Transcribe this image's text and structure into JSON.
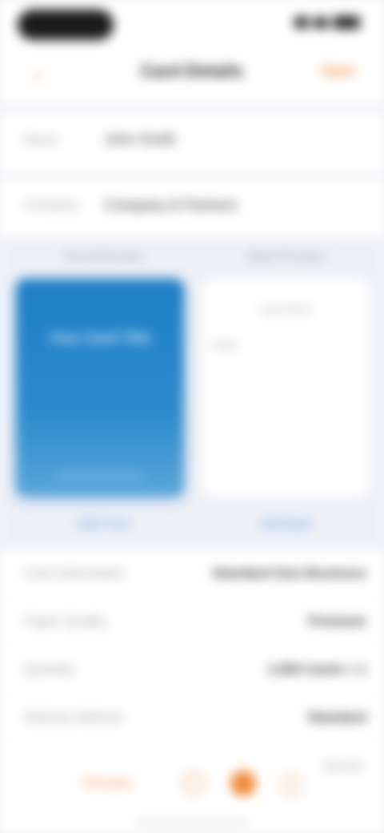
{
  "status_bar": {
    "time": ""
  },
  "nav": {
    "back": "‹",
    "title": "Card Details",
    "action": "Save"
  },
  "form": [
    {
      "label": "Name",
      "value": "John Smith"
    },
    {
      "label": "Company",
      "value": "Company & Partners"
    }
  ],
  "cards": {
    "left": {
      "title": "Front Preview",
      "heading": "Your Card Title",
      "link": "Edit Front"
    },
    "right": {
      "title": "Back Preview",
      "inner_title": "Card Back",
      "inner_label": "Notes",
      "link": "Edit Back"
    }
  },
  "info": [
    {
      "label": "Card Information",
      "value": "Standard Size Business"
    },
    {
      "label": "Paper Quality",
      "value": "Premium"
    },
    {
      "label": "Quantity",
      "value": "1,000 Cards × 1"
    },
    {
      "label": "Delivery Method",
      "value": "Standard"
    }
  ],
  "bottom": {
    "link": "Preview",
    "right_text": "Subtotal"
  },
  "colors": {
    "accent": "#ee8a3c",
    "card_blue": "#1f7fc6"
  }
}
